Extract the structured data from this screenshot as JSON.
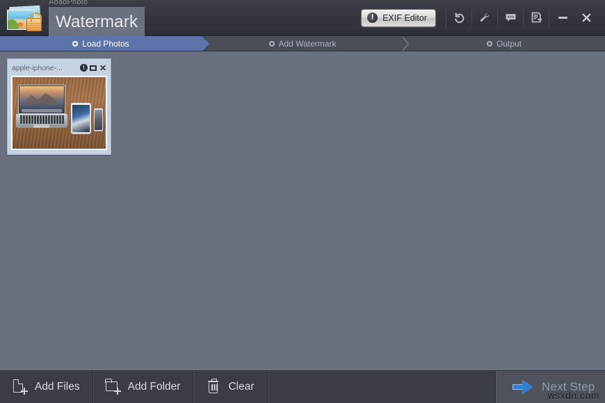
{
  "titlebar": {
    "logo_icon": "photo-lock-icon",
    "brand_sub": "AoaoPhoto",
    "brand_main": "Watermark",
    "exif_button": "EXIF Editor",
    "exif_icon": "exclamation-circle-icon",
    "tool_icons": [
      {
        "name": "undo-icon"
      },
      {
        "name": "wrench-icon"
      },
      {
        "name": "feedback-bubble-icon"
      },
      {
        "name": "register-document-icon"
      }
    ],
    "minimize_label": "Minimize",
    "close_label": "Close"
  },
  "steps": [
    {
      "label": "Load Photos",
      "active": true
    },
    {
      "label": "Add Watermark",
      "active": false
    },
    {
      "label": "Output",
      "active": false
    }
  ],
  "main": {
    "thumbnail": {
      "title": "apple-iphone-...",
      "info_icon": "info-icon",
      "preview_icon": "preview-icon",
      "close_icon": "close-icon",
      "image_alt": "laptop-tablet-phone-on-desk"
    }
  },
  "bottom": {
    "buttons": [
      {
        "label": "Add Files",
        "icon": "add-file-icon"
      },
      {
        "label": "Add Folder",
        "icon": "add-folder-icon"
      },
      {
        "label": "Clear",
        "icon": "trash-icon"
      }
    ],
    "next_step": {
      "label": "Next Step",
      "icon": "arrow-right-icon"
    }
  },
  "watermark": "wsxdn.com",
  "colors": {
    "accent_blue": "#5d74ab",
    "arrow_blue": "#2f7fd6",
    "main_bg": "#6b707e",
    "titlebar_bg": "#34373d",
    "bottom_bg": "#3a3d44",
    "card_bg": "#c6d2e1"
  }
}
